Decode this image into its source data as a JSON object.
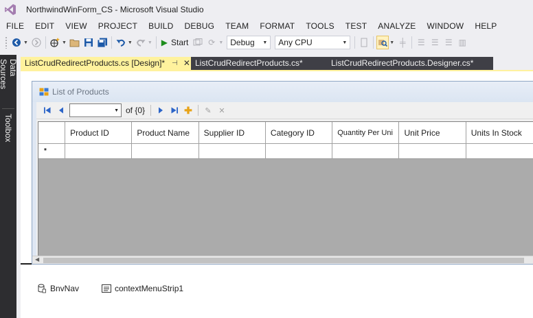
{
  "window": {
    "title": "NorthwindWinForm_CS - Microsoft Visual Studio"
  },
  "menu": [
    "FILE",
    "EDIT",
    "VIEW",
    "PROJECT",
    "BUILD",
    "DEBUG",
    "TEAM",
    "FORMAT",
    "TOOLS",
    "TEST",
    "ANALYZE",
    "WINDOW",
    "HELP"
  ],
  "toolbar": {
    "start_label": "Start",
    "configuration": "Debug",
    "platform": "Any CPU"
  },
  "side_panels": {
    "data_sources": "Data Sources",
    "toolbox": "Toolbox"
  },
  "tabs": [
    {
      "label": "ListCrudRedirectProducts.cs [Design]*",
      "active": true
    },
    {
      "label": "ListCrudRedirectProducts.cs*",
      "active": false
    },
    {
      "label": "ListCrudRedirectProducts.Designer.cs*",
      "active": false
    }
  ],
  "form": {
    "title": "List of Products",
    "navigator": {
      "position_value": "",
      "count_label": "of {0}"
    },
    "grid": {
      "columns": [
        "Product ID",
        "Product Name",
        "Supplier ID",
        "Category ID",
        "Quantity Per Uni",
        "Unit Price",
        "Units In Stock"
      ],
      "new_row_marker": "*"
    }
  },
  "tray": {
    "items": [
      "BnvNav",
      "contextMenuStrip1"
    ]
  },
  "colors": {
    "active_tab": "#fff29d",
    "inactive_tab": "#3f3f46",
    "side_panel": "#2d2d30",
    "grid_background": "#ababab"
  }
}
